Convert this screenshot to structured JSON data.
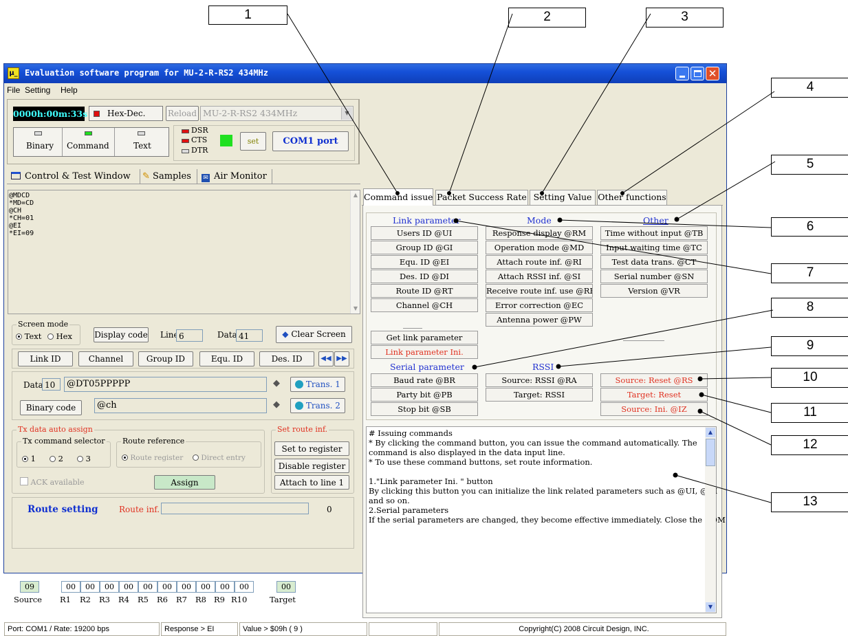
{
  "callouts": [
    "1",
    "2",
    "3",
    "4",
    "5",
    "6",
    "7",
    "8",
    "9",
    "10",
    "11",
    "12",
    "13"
  ],
  "window": {
    "title": "Evaluation software program for MU-2-R-RS2  434MHz",
    "title_icon_text": "μ_"
  },
  "menu": [
    "File",
    "Setting",
    "Help"
  ],
  "toolbar": {
    "timer": "0000h:00m:33s",
    "hexdec_label": "Hex-Dec.",
    "reload_label": "Reload",
    "model_select": "MU-2-R-RS2  434MHz",
    "binary": "Binary",
    "command": "Command",
    "text": "Text",
    "dsr": "DSR",
    "cts": "CTS",
    "dtr": "DTR",
    "set": "set",
    "com_port": "COM1 port"
  },
  "left_tabs": [
    "Control  & Test Window",
    "Samples",
    "Air Monitor"
  ],
  "log_lines": [
    "@MDCD",
    "*MD=CD",
    "@CH",
    "*CH=01",
    "@EI",
    "*EI=09"
  ],
  "screen_mode": {
    "label": "Screen mode",
    "text": "Text",
    "hex": "Hex",
    "display_code": "Display code",
    "line_label": "Line",
    "line_value": "6",
    "data_label": "Data",
    "data_value": "41",
    "clear_screen": "Clear Screen"
  },
  "id_buttons": [
    "Link ID",
    "Channel",
    "Group ID",
    "Equ. ID",
    "Des. ID"
  ],
  "data_line": {
    "label": "Data",
    "length": "10",
    "value": "@DT05PPPPP",
    "trans1": "Trans. 1",
    "binary_code": "Binary code",
    "value2": "@ch",
    "trans2": "Trans. 2"
  },
  "tx_auto": {
    "label": "Tx data auto assign",
    "selector_label": "Tx command selector",
    "opt1": "1",
    "opt2": "2",
    "opt3": "3",
    "route_ref_label": "Route reference",
    "route_register": "Route register",
    "direct_entry": "Direct entry",
    "ack": "ACK available",
    "assign": "Assign"
  },
  "set_route": {
    "label": "Set route inf.",
    "set_to_register": "Set to register",
    "disable_register": "Disable register",
    "attach_line1": "Attach to line 1"
  },
  "route_setting": {
    "title": "Route setting",
    "route_inf_label": "Route inf.",
    "count": "0",
    "values": [
      "09",
      "00",
      "00",
      "00",
      "00",
      "00",
      "00",
      "00",
      "00",
      "00",
      "00",
      "00"
    ],
    "labels": [
      "Source",
      "R1",
      "R2",
      "R3",
      "R4",
      "R5",
      "R6",
      "R7",
      "R8",
      "R9",
      "R10",
      "Target"
    ]
  },
  "right_tabs": [
    "Command issue",
    "Packet Success Rate",
    "Setting Value",
    "Other functions"
  ],
  "cmd_panel": {
    "link_heading": "Link parameter",
    "mode_heading": "Mode",
    "other_heading": "Other",
    "link": [
      "Users ID @UI",
      "Group ID @GI",
      "Equ. ID @EI",
      "Des. ID @DI",
      "Route ID @RT",
      "Channel @CH"
    ],
    "mode": [
      "Response display @RM",
      "Operation mode @MD",
      "Attach route inf. @RI",
      "Attach RSSI inf. @SI",
      "Receive route inf. use @RR",
      "Error correction @EC",
      "Antenna power @PW"
    ],
    "other": [
      "Time without input @TB",
      "Input waiting time @TC",
      "Test data trans. @CT",
      "Serial number @SN",
      "Version @VR"
    ],
    "get_link": "Get link parameter",
    "link_ini": "Link parameter Ini.",
    "serial_heading": "Serial parameter",
    "rssi_heading": "RSSI",
    "serial": [
      "Baud rate @BR",
      "Party bit @PB",
      "Stop bit @SB"
    ],
    "rssi": [
      "Source: RSSI @RA",
      "Target: RSSI"
    ],
    "reset": [
      "Source: Reset @RS",
      "Target: Reset",
      "Source: Ini. @IZ"
    ]
  },
  "help_text": [
    "# Issuing commands",
    "* By clicking the command button, you can issue the command automatically. The",
    "command is also displayed in the data input line.",
    "* To use these command buttons, set route information.",
    "",
    "1.\"Link parameter Ini. \" button",
    "By clicking this button you can initialize the link related parameters such as @UI, @GI",
    "and so on.",
    "2.Serial parameters",
    "If the serial parameters are changed, they become effective immediately. Close the COM"
  ],
  "status": {
    "port": "Port: COM1 / Rate: 19200 bps",
    "response": "Response > EI",
    "value": "Value > $09h ( 9 )",
    "copyright": "Copyright(C) 2008 Circuit Design, INC."
  },
  "colors": {
    "title_blue": "#0f4fd8",
    "led_red": "#e01010",
    "led_green": "#20e020",
    "link_blue": "#2030d0",
    "reset_red": "#e03020"
  }
}
